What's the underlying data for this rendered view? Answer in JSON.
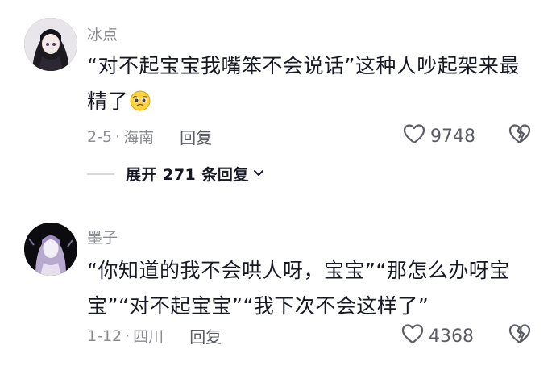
{
  "comments": [
    {
      "username": "冰点",
      "text": "“对不起宝宝我嘴笨不会说话”这种人吵起架来最精了",
      "emoji": "crying-face-emoji",
      "date": "2-5",
      "separator": "·",
      "location": "海南",
      "reply_label": "回复",
      "likes": "9748",
      "expand_label": "展开 271 条回复"
    },
    {
      "username": "墨子",
      "text": "“你知道的我不会哄人呀，宝宝”“那怎么办呀宝宝”“对不起宝宝”“我下次不会这样了”",
      "date": "1-12",
      "separator": "·",
      "location": "四川",
      "reply_label": "回复",
      "likes": "4368"
    }
  ],
  "colors": {
    "text": "#161823",
    "secondary": "#8a8b91",
    "icon": "#5a5b63"
  }
}
